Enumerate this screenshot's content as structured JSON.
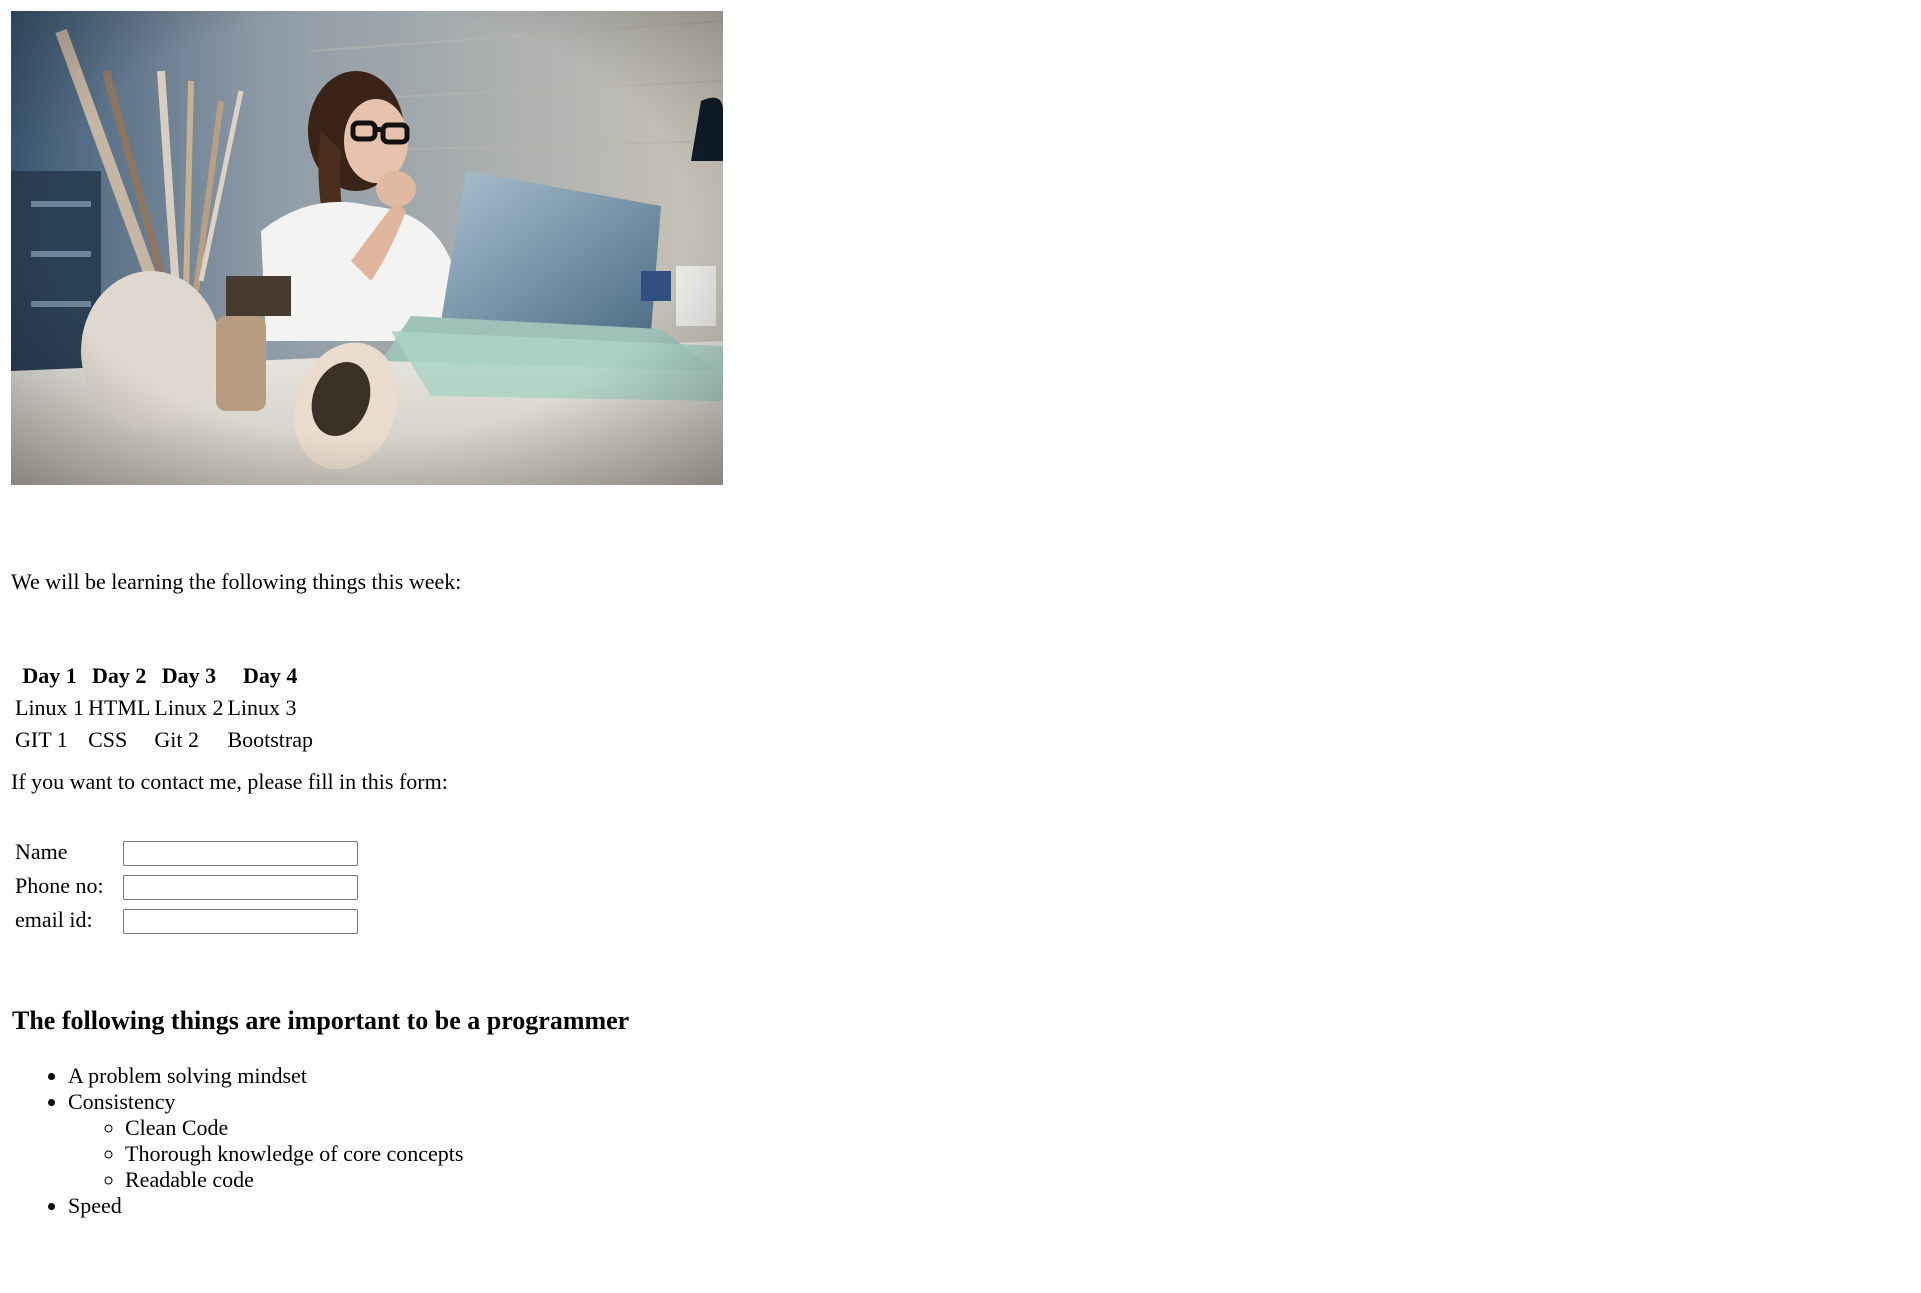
{
  "photo": {
    "alt": "Woman at laptop thinking"
  },
  "intro_text": "We will be learning the following things this week:",
  "schedule": {
    "headers": [
      "Day 1",
      "Day 2",
      "Day 3",
      "Day 4"
    ],
    "rows": [
      [
        "Linux 1",
        "HTML",
        "Linux 2",
        "Linux 3"
      ],
      [
        "GIT 1",
        "CSS",
        "Git 2",
        "Bootstrap"
      ]
    ]
  },
  "contact_text": "If you want to contact me, please fill in this form:",
  "form": {
    "name_label": "Name",
    "name_value": "",
    "phone_label": "Phone no:",
    "phone_value": "",
    "email_label": "email id:",
    "email_value": ""
  },
  "important_heading": "The following things are important to be a programmer",
  "list": {
    "item1": "A problem solving mindset",
    "item2": "Consistency",
    "sub1": "Clean Code",
    "sub2": "Thorough knowledge of core concepts",
    "sub3": "Readable code",
    "item3": "Speed"
  }
}
